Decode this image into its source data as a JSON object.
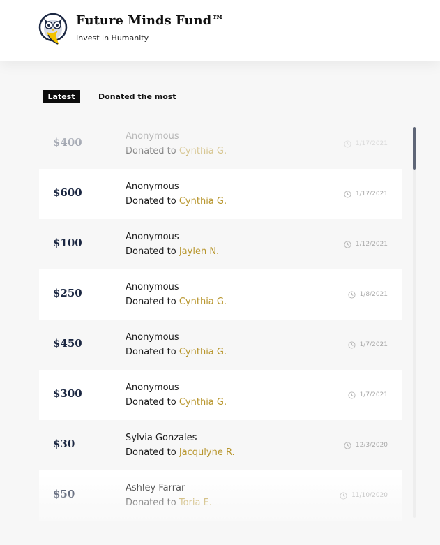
{
  "brand": {
    "title": "Future Minds Fund™",
    "tagline": "Invest in Humanity",
    "logo_icon": "owl-logo-icon"
  },
  "tabs": [
    {
      "label": "Latest",
      "active": true
    },
    {
      "label": "Donated the most",
      "active": false
    }
  ],
  "colors": {
    "recipient": "#b8962e",
    "amount": "#1b2742",
    "scroll_thumb": "#5f6677",
    "active_tab_bg": "#0d0d0d"
  },
  "donations": [
    {
      "amount": "$400",
      "donor": "Anonymous",
      "prefix": "Donated to",
      "recipient": "Cynthia G.",
      "date": "1/17/2021"
    },
    {
      "amount": "$600",
      "donor": "Anonymous",
      "prefix": "Donated to",
      "recipient": "Cynthia G.",
      "date": "1/17/2021"
    },
    {
      "amount": "$100",
      "donor": "Anonymous",
      "prefix": "Donated to",
      "recipient": "Jaylen N.",
      "date": "1/12/2021"
    },
    {
      "amount": "$250",
      "donor": "Anonymous",
      "prefix": "Donated to",
      "recipient": "Cynthia G.",
      "date": "1/8/2021"
    },
    {
      "amount": "$450",
      "donor": "Anonymous",
      "prefix": "Donated to",
      "recipient": "Cynthia G.",
      "date": "1/7/2021"
    },
    {
      "amount": "$300",
      "donor": "Anonymous",
      "prefix": "Donated to",
      "recipient": "Cynthia G.",
      "date": "1/7/2021"
    },
    {
      "amount": "$30",
      "donor": "Sylvia Gonzales",
      "prefix": "Donated to",
      "recipient": "Jacqulyne R.",
      "date": "12/3/2020"
    },
    {
      "amount": "$50",
      "donor": "Ashley Farrar",
      "prefix": "Donated to",
      "recipient": "Toria E.",
      "date": "11/10/2020"
    }
  ],
  "icons": {
    "date": "clock-icon"
  }
}
